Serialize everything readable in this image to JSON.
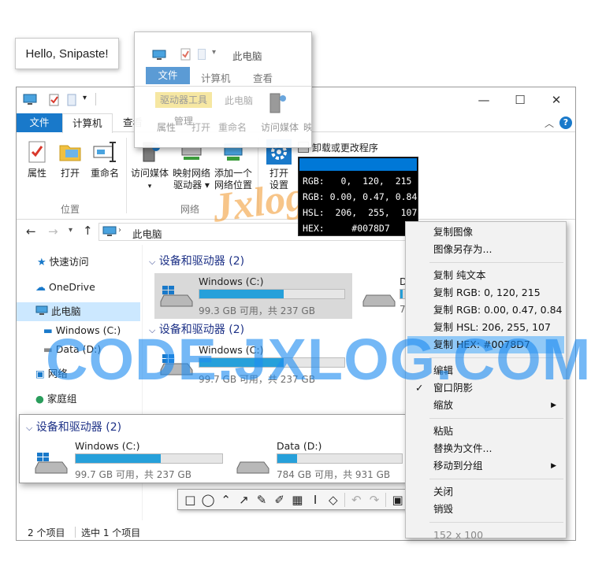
{
  "hello_text": "Hello, Snipaste!",
  "explorer": {
    "title": "此电脑",
    "tabs": [
      "文件",
      "计算机",
      "查看"
    ],
    "ribbon": {
      "location_buttons": [
        "属性",
        "打开",
        "重命名"
      ],
      "location_group": "位置",
      "network_buttons": [
        "访问媒体",
        "映射网络驱动器",
        "添加一个网络位置"
      ],
      "network_button_lines": [
        [
          "访问媒体"
        ],
        [
          "映射网络",
          "驱动器 ▾"
        ],
        [
          "添加一个",
          "网络位置"
        ]
      ],
      "network_group": "网络",
      "settings_button": [
        "打开",
        "设置"
      ],
      "uninstall_label": "卸载或更改程序"
    },
    "address": "此电脑",
    "nav": [
      "快速访问",
      "OneDrive",
      "此电脑",
      "Windows (C:)",
      "Data (D:)",
      "网络",
      "家庭组"
    ],
    "group_header": "设备和驱动器 (2)",
    "drives": [
      {
        "name": "Windows (C:)",
        "size": "99.3 GB 可用，共 237 GB",
        "used": 0.58
      },
      {
        "name": "Windows (C:)",
        "size": "99.7 GB 可用，共 237 GB",
        "used": 0.58
      },
      {
        "name": "D",
        "size": "78",
        "used": 0.16
      }
    ],
    "status_items": "2 个项目",
    "status_selected": "选中 1 个项目"
  },
  "snip_ribbon": {
    "title": "此电脑",
    "tabs": [
      "文件",
      "计算机",
      "查看"
    ],
    "drive_tools": "驱动器工具",
    "this_pc": "此电脑",
    "labels": [
      "属性",
      "管理",
      "打开",
      "重命名",
      "访问媒体",
      "映"
    ]
  },
  "snip_drives": {
    "header": "设备和驱动器 (2)",
    "drives": [
      {
        "name": "Windows (C:)",
        "size": "99.7 GB 可用，共 237 GB",
        "used": 0.58
      },
      {
        "name": "Data (D:)",
        "size": "784 GB 可用，共 931 GB",
        "used": 0.16
      }
    ]
  },
  "picker": {
    "color": "#0078d7",
    "rgb": "RGB:   0,  120,  215",
    "rgbf": "RGB: 0.00, 0.47, 0.84",
    "hsl": "HSL:  206,  255,  107",
    "hex": "HEX:     #0078D7"
  },
  "menu": {
    "items": [
      {
        "label": "复制图像"
      },
      {
        "label": "图像另存为..."
      },
      {
        "sep": true
      },
      {
        "label": "复制 纯文本"
      },
      {
        "label": "复制 RGB: 0, 120, 215"
      },
      {
        "label": "复制 RGB: 0.00, 0.47, 0.84"
      },
      {
        "label": "复制 HSL: 206, 255, 107"
      },
      {
        "label": "复制 HEX: #0078D7",
        "highlight": true
      },
      {
        "sep": true
      },
      {
        "label": "编辑"
      },
      {
        "label": "窗口阴影",
        "checked": true
      },
      {
        "label": "缩放",
        "submenu": true
      },
      {
        "sep": true
      },
      {
        "label": "粘贴"
      },
      {
        "label": "替换为文件..."
      },
      {
        "label": "移动到分组",
        "submenu": true
      },
      {
        "sep": true
      },
      {
        "label": "关闭"
      },
      {
        "label": "销毁"
      },
      {
        "sep": true
      },
      {
        "label": "152 x 100",
        "disabled": true
      }
    ]
  },
  "toolbar": [
    "rectangle-tool",
    "ellipse-tool",
    "polyline-tool",
    "arrow-tool",
    "pencil-tool",
    "marker-tool",
    "mosaic-tool",
    "text-tool",
    "eraser-tool",
    "undo",
    "redo",
    "save"
  ],
  "watermark_code": "CODE.JXLOG.COM",
  "watermark_logo": "Jxlog",
  "colors": {
    "accent": "#0078d7",
    "file_tab": "#1979ca",
    "selection": "#cce8ff",
    "menu_highlight": "#91c9f7",
    "bar_fill": "#26a0da"
  }
}
